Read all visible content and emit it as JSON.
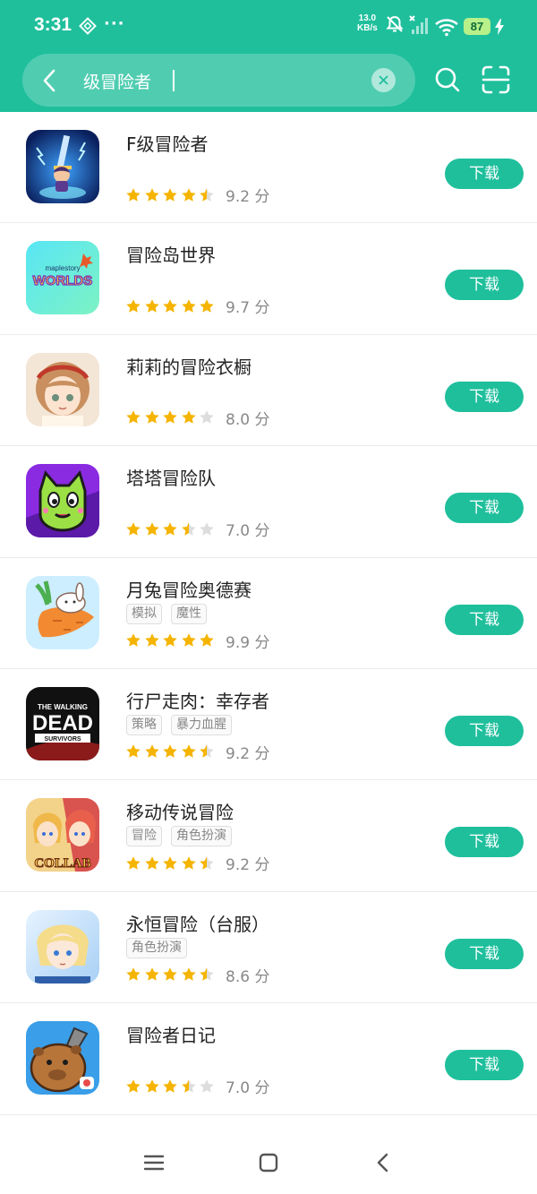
{
  "status_bar": {
    "time": "3:31",
    "dots": "···",
    "net_speed": "13.0",
    "net_unit": "KB/s",
    "battery": "87"
  },
  "search": {
    "query": "级冒险者",
    "clear_icon": "close-icon",
    "search_icon": "search-icon",
    "scan_icon": "scan-icon"
  },
  "apps": [
    {
      "title": "F级冒险者",
      "tags": [],
      "rating": 4.5,
      "score": "9.2 分",
      "button": "下载"
    },
    {
      "title": "冒险岛世界",
      "tags": [],
      "rating": 5,
      "score": "9.7 分",
      "button": "下载"
    },
    {
      "title": "莉莉的冒险衣橱",
      "tags": [],
      "rating": 4,
      "score": "8.0 分",
      "button": "下载"
    },
    {
      "title": "塔塔冒险队",
      "tags": [],
      "rating": 3.5,
      "score": "7.0 分",
      "button": "下载"
    },
    {
      "title": "月兔冒险奥德赛",
      "tags": [
        "模拟",
        "魔性"
      ],
      "rating": 5,
      "score": "9.9 分",
      "button": "下载"
    },
    {
      "title": "行尸走肉：幸存者",
      "tags": [
        "策略",
        "暴力血腥"
      ],
      "rating": 4.5,
      "score": "9.2 分",
      "button": "下载"
    },
    {
      "title": "移动传说冒险",
      "tags": [
        "冒险",
        "角色扮演"
      ],
      "rating": 4.5,
      "score": "9.2 分",
      "button": "下载"
    },
    {
      "title": "永恒冒险（台服）",
      "tags": [
        "角色扮演"
      ],
      "rating": 4.5,
      "score": "8.6 分",
      "button": "下载"
    },
    {
      "title": "冒险者日记",
      "tags": [],
      "rating": 3.5,
      "score": "7.0 分",
      "button": "下载"
    }
  ],
  "icon_art": [
    {
      "name": "sword-knight-icon",
      "text": ""
    },
    {
      "name": "maplestory-worlds-icon",
      "text": "WORLDS",
      "sub": "maplestory"
    },
    {
      "name": "girl-portrait-icon",
      "text": ""
    },
    {
      "name": "cat-creature-icon",
      "text": ""
    },
    {
      "name": "rabbit-carrot-icon",
      "text": ""
    },
    {
      "name": "walking-dead-icon",
      "text": "DEAD",
      "sub": "THE WALKING",
      "sub2": "SURVIVORS"
    },
    {
      "name": "anime-collab-icon",
      "text": "COLLAB"
    },
    {
      "name": "blonde-hero-icon",
      "text": ""
    },
    {
      "name": "capybara-icon",
      "text": ""
    }
  ],
  "colors": {
    "accent": "#1fbf9c",
    "star": "#f5b400",
    "star_empty": "#dddddd"
  },
  "nav": [
    "menu-icon",
    "home-icon",
    "back-icon"
  ]
}
